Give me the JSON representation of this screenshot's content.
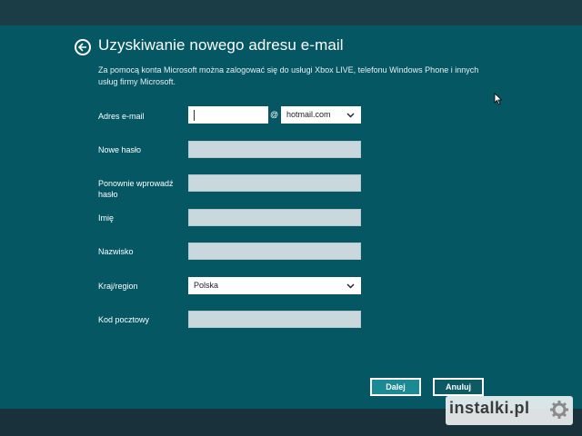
{
  "header": {
    "title": "Uzyskiwanie nowego adresu e-mail",
    "description": "Za pomocą konta Microsoft można zalogować się do usługi Xbox LIVE, telefonu Windows Phone i innych usług firmy Microsoft."
  },
  "form": {
    "email_label": "Adres e-mail",
    "email_value": "",
    "at_sign": "@",
    "domain_value": "hotmail.com",
    "password_label": "Nowe hasło",
    "password_value": "",
    "password_confirm_label": "Ponownie wprowadź hasło",
    "password_confirm_value": "",
    "first_name_label": "Imię",
    "first_name_value": "",
    "last_name_label": "Nazwisko",
    "last_name_value": "",
    "country_label": "Kraj/region",
    "country_value": "Polska",
    "postal_label": "Kod pocztowy",
    "postal_value": ""
  },
  "buttons": {
    "next": "Dalej",
    "cancel": "Anuluj"
  },
  "watermark": {
    "text": "instalki.pl"
  },
  "icons": {
    "back": "back-arrow-icon",
    "dropdown": "chevron-down-icon",
    "cursor": "mouse-pointer-icon",
    "logo": "gear-icon"
  },
  "colors": {
    "panel": "#055763",
    "background": "#1b3d46",
    "field": "#c9d8dc",
    "primary_button": "#1b8a94"
  }
}
